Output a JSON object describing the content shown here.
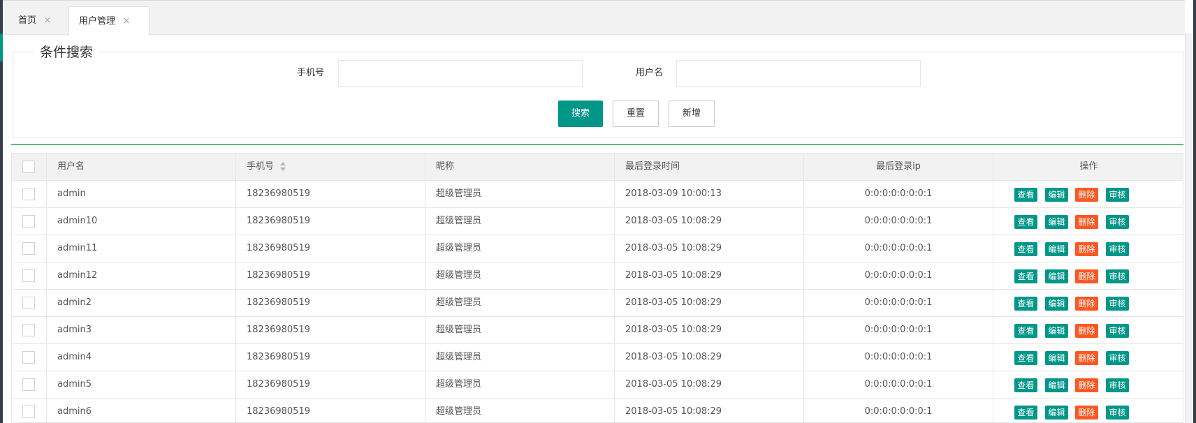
{
  "tabs": [
    {
      "label": "首页",
      "close": "×"
    },
    {
      "label": "用户管理",
      "close": "×"
    }
  ],
  "search": {
    "legend": "条件搜索",
    "phone_label": "手机号",
    "phone_value": "",
    "username_label": "用户名",
    "username_value": "",
    "search_btn": "搜索",
    "reset_btn": "重置",
    "add_btn": "新增"
  },
  "table": {
    "headers": {
      "username": "用户名",
      "phone": "手机号",
      "nickname": "昵称",
      "last_login_time": "最后登录时间",
      "last_login_ip": "最后登录ip",
      "actions": "操作"
    },
    "action_labels": {
      "view": "查看",
      "edit": "编辑",
      "delete": "删除",
      "audit": "审核"
    },
    "rows": [
      {
        "username": "admin",
        "phone": "18236980519",
        "nickname": "超级管理员",
        "time": "2018-03-09 10:00:13",
        "ip": "0:0:0:0:0:0:0:1"
      },
      {
        "username": "admin10",
        "phone": "18236980519",
        "nickname": "超级管理员",
        "time": "2018-03-05 10:08:29",
        "ip": "0:0:0:0:0:0:0:1"
      },
      {
        "username": "admin11",
        "phone": "18236980519",
        "nickname": "超级管理员",
        "time": "2018-03-05 10:08:29",
        "ip": "0:0:0:0:0:0:0:1"
      },
      {
        "username": "admin12",
        "phone": "18236980519",
        "nickname": "超级管理员",
        "time": "2018-03-05 10:08:29",
        "ip": "0:0:0:0:0:0:0:1"
      },
      {
        "username": "admin2",
        "phone": "18236980519",
        "nickname": "超级管理员",
        "time": "2018-03-05 10:08:29",
        "ip": "0:0:0:0:0:0:0:1"
      },
      {
        "username": "admin3",
        "phone": "18236980519",
        "nickname": "超级管理员",
        "time": "2018-03-05 10:08:29",
        "ip": "0:0:0:0:0:0:0:1"
      },
      {
        "username": "admin4",
        "phone": "18236980519",
        "nickname": "超级管理员",
        "time": "2018-03-05 10:08:29",
        "ip": "0:0:0:0:0:0:0:1"
      },
      {
        "username": "admin5",
        "phone": "18236980519",
        "nickname": "超级管理员",
        "time": "2018-03-05 10:08:29",
        "ip": "0:0:0:0:0:0:0:1"
      },
      {
        "username": "admin6",
        "phone": "18236980519",
        "nickname": "超级管理员",
        "time": "2018-03-05 10:08:29",
        "ip": "0:0:0:0:0:0:0:1"
      }
    ]
  },
  "colors": {
    "primary": "#009688",
    "danger": "#ff5722",
    "divider": "#5fb878"
  }
}
